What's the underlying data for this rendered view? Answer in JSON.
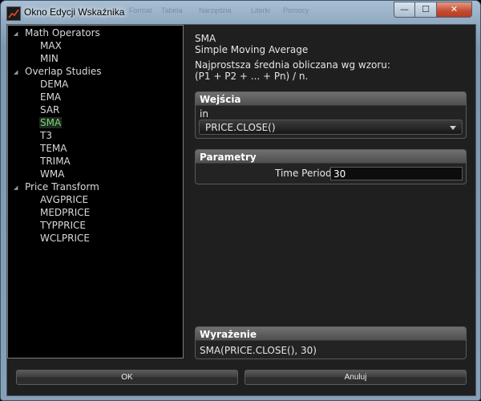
{
  "window": {
    "title": "Okno Edycji Wskaźnika",
    "background_menu": [
      "Format",
      "Tabela",
      "Narzędzia",
      "Literki",
      "Pomocy"
    ],
    "controls": {
      "minimize": "—",
      "maximize": "☐",
      "close": "✕"
    }
  },
  "tree": {
    "groups": [
      {
        "label": "Math Operators",
        "items": [
          "MAX",
          "MIN"
        ]
      },
      {
        "label": "Overlap Studies",
        "items": [
          "DEMA",
          "EMA",
          "SAR",
          "SMA",
          "T3",
          "TEMA",
          "TRIMA",
          "WMA"
        ]
      },
      {
        "label": "Price Transform",
        "items": [
          "AVGPRICE",
          "MEDPRICE",
          "TYPPRICE",
          "WCLPRICE"
        ]
      }
    ],
    "selected": "SMA"
  },
  "details": {
    "code": "SMA",
    "name": "Simple Moving Average",
    "desc_line1": "Najprostsza średnia obliczana wg wzoru:",
    "desc_line2": "(P1 + P2 + ... + Pn) / n."
  },
  "inputs": {
    "header": "Wejścia",
    "label": "in",
    "value": "PRICE.CLOSE()"
  },
  "params": {
    "header": "Parametry",
    "time_period_label": "Time Period:",
    "time_period_value": "30"
  },
  "expression": {
    "header": "Wyrażenie",
    "value": "SMA(PRICE.CLOSE(), 30)"
  },
  "buttons": {
    "ok": "OK",
    "cancel": "Anuluj"
  },
  "colors": {
    "selected_item": "#7fd47f",
    "panel_bg": "#000000",
    "window_chrome": "#8fa8bf",
    "close_button": "#c44b2f"
  }
}
